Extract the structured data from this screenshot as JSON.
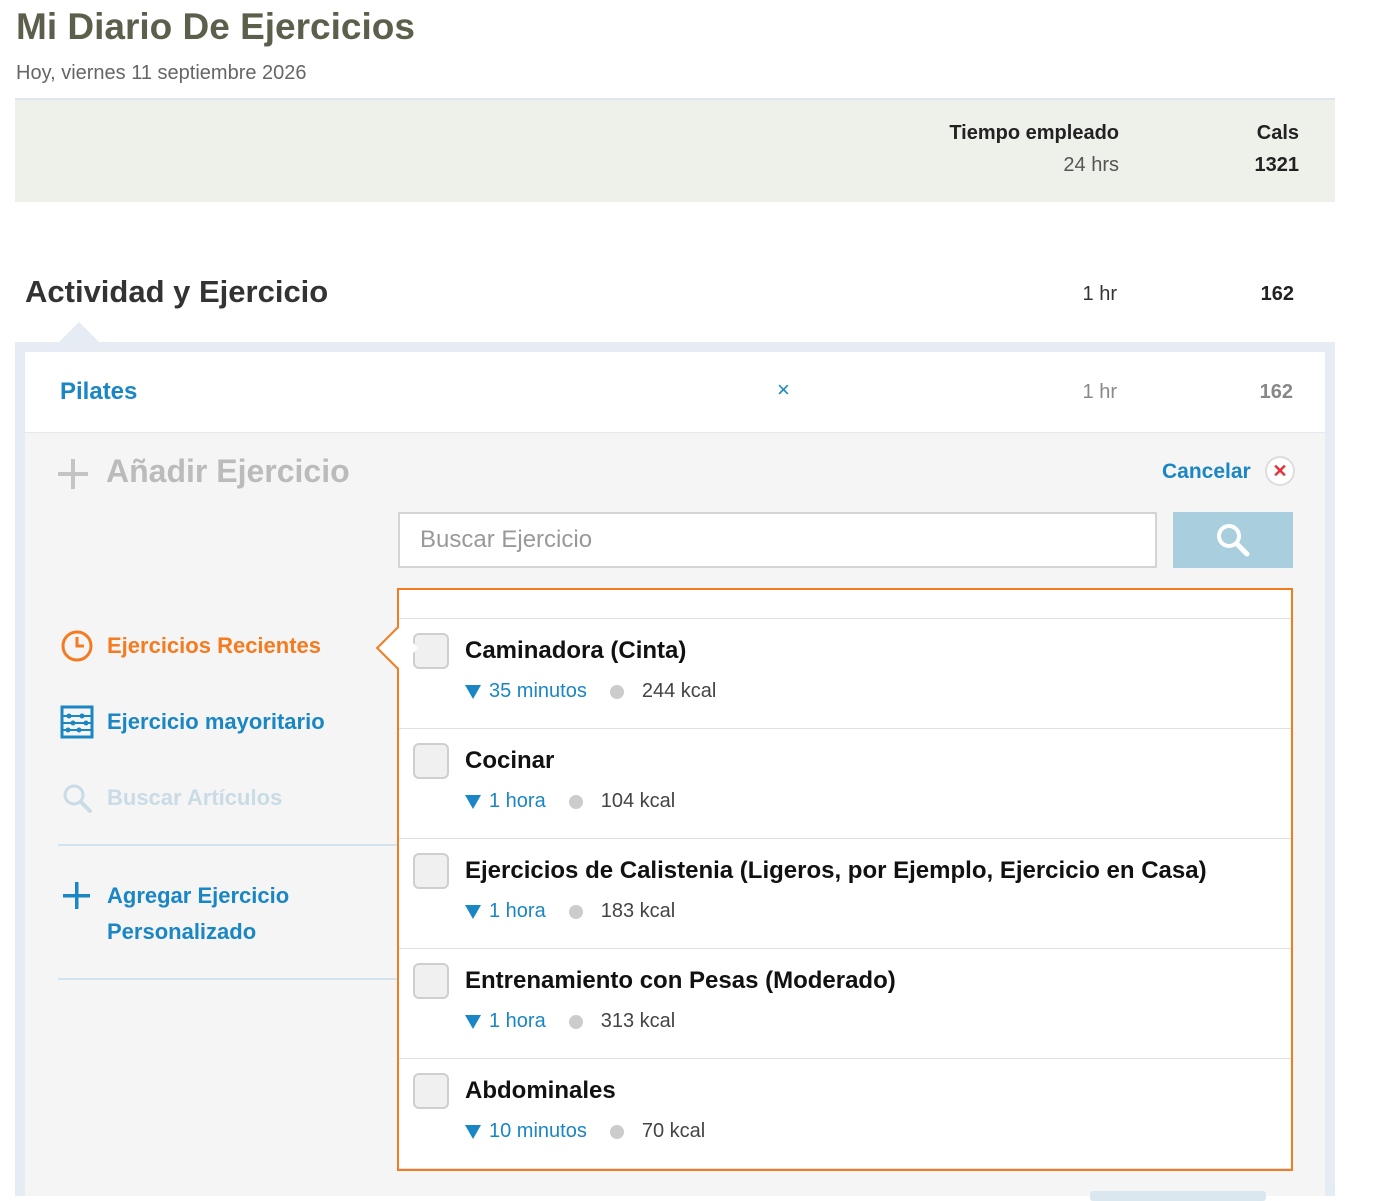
{
  "header": {
    "title": "Mi Diario De Ejercicios",
    "date": "Hoy, viernes 11 septiembre 2026"
  },
  "summary": {
    "time_label": "Tiempo empleado",
    "time_value": "24 hrs",
    "cals_label": "Cals",
    "cals_value": "1321"
  },
  "section": {
    "title": "Actividad y Ejercicio",
    "time": "1 hr",
    "cals": "162"
  },
  "logged": [
    {
      "name": "Pilates",
      "remove": "×",
      "time": "1 hr",
      "cals": "162"
    }
  ],
  "add_panel": {
    "title": "Añadir Ejercicio",
    "cancel_label": "Cancelar",
    "search_placeholder": "Buscar Ejercicio",
    "side_nav": {
      "recent": "Ejercicios Recientes",
      "most": "Ejercicio mayoritario",
      "search": "Buscar Artículos",
      "custom": "Agregar Ejercicio Personalizado"
    },
    "results": [
      {
        "name": "Caminadora (Cinta)",
        "duration": "35 minutos",
        "kcal": "244 kcal"
      },
      {
        "name": "Cocinar",
        "duration": "1 hora",
        "kcal": "104 kcal"
      },
      {
        "name": "Ejercicios de Calistenia (Ligeros, por Ejemplo, Ejercicio en Casa)",
        "duration": "1 hora",
        "kcal": "183 kcal"
      },
      {
        "name": "Entrenamiento con Pesas (Moderado)",
        "duration": "1 hora",
        "kcal": "313 kcal"
      },
      {
        "name": "Abdominales",
        "duration": "10 minutos",
        "kcal": "70 kcal"
      }
    ]
  },
  "colors": {
    "accent_blue": "#1b86c4",
    "accent_orange": "#f47b20",
    "title_olive": "#5d5f4c",
    "summary_bg": "#eef0ea",
    "cancel_red": "#e8303a"
  }
}
